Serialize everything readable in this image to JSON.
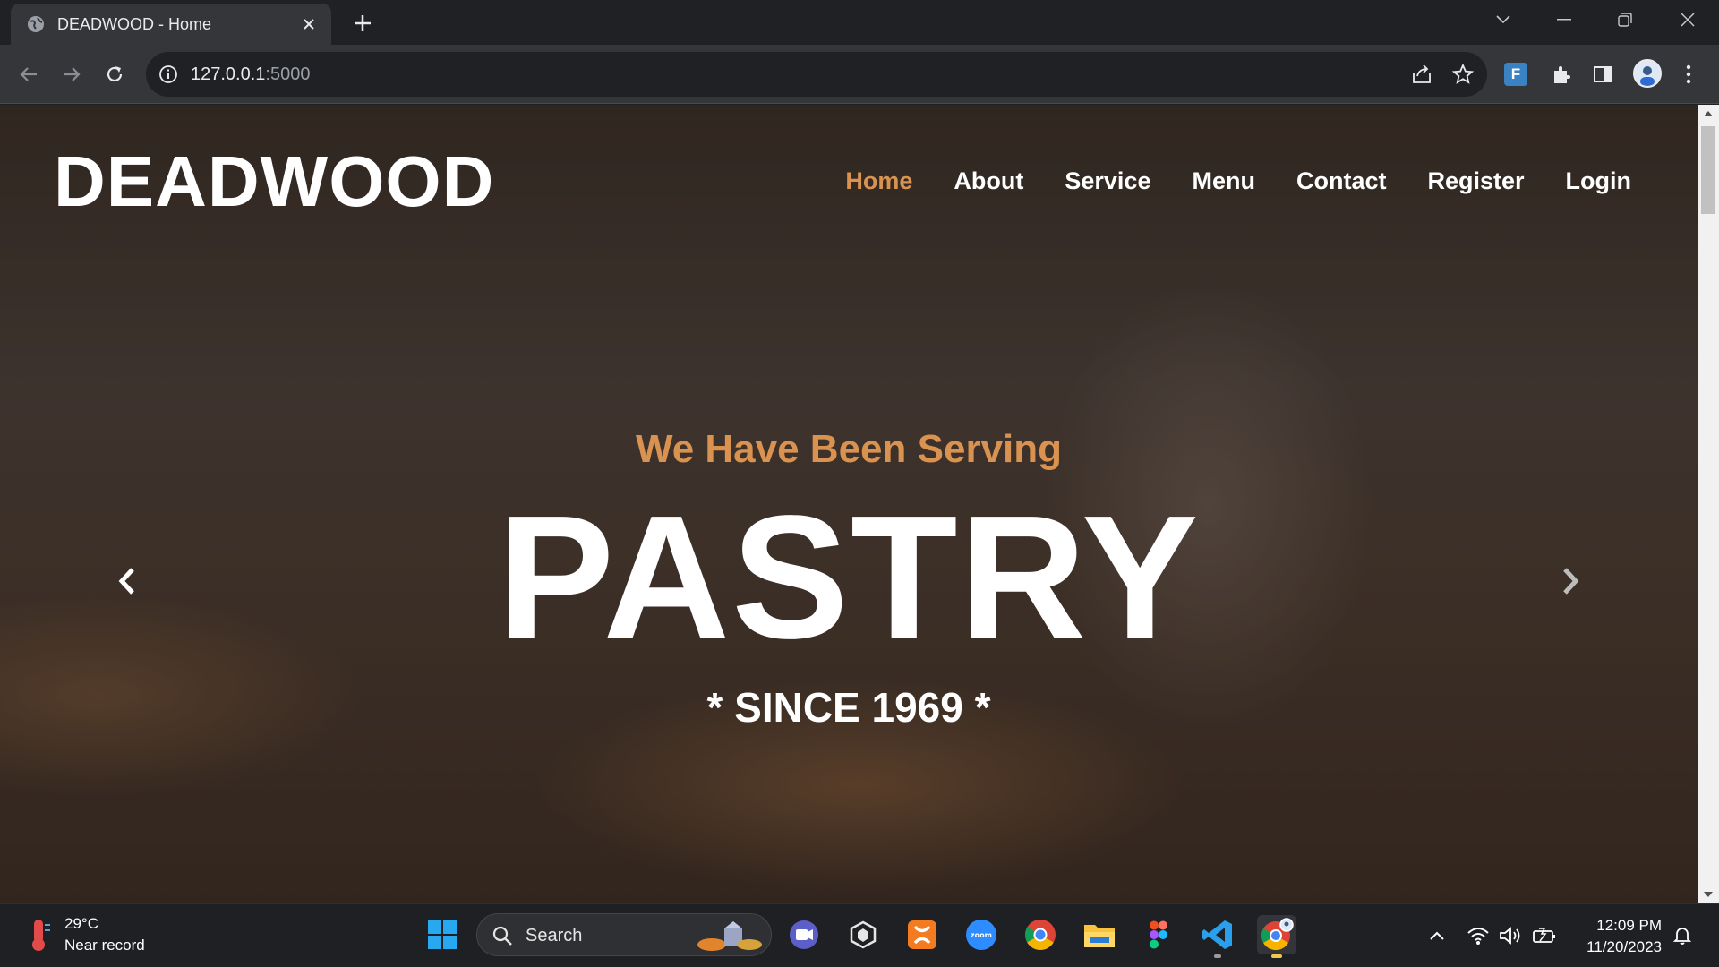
{
  "browser": {
    "tab_title": "DEADWOOD - Home",
    "url_host": "127.0.0.1",
    "url_port": ":5000"
  },
  "site": {
    "brand": "DEADWOOD",
    "nav": [
      {
        "label": "Home",
        "active": true
      },
      {
        "label": "About"
      },
      {
        "label": "Service"
      },
      {
        "label": "Menu"
      },
      {
        "label": "Contact"
      },
      {
        "label": "Register"
      },
      {
        "label": "Login"
      }
    ],
    "hero": {
      "subtitle": "We Have Been Serving",
      "title": "PASTRY",
      "since": "* SINCE 1969 *"
    },
    "colors": {
      "accent": "#d9924f",
      "text": "#ffffff"
    }
  },
  "taskbar": {
    "weather_temp": "29°C",
    "weather_desc": "Near record",
    "search_label": "Search",
    "apps": [
      "windows-start",
      "search",
      "meet",
      "unity",
      "xampp",
      "zoom",
      "chrome",
      "file-explorer",
      "figma",
      "vscode",
      "chrome-profile"
    ],
    "time": "12:09 PM",
    "date": "11/20/2023"
  }
}
